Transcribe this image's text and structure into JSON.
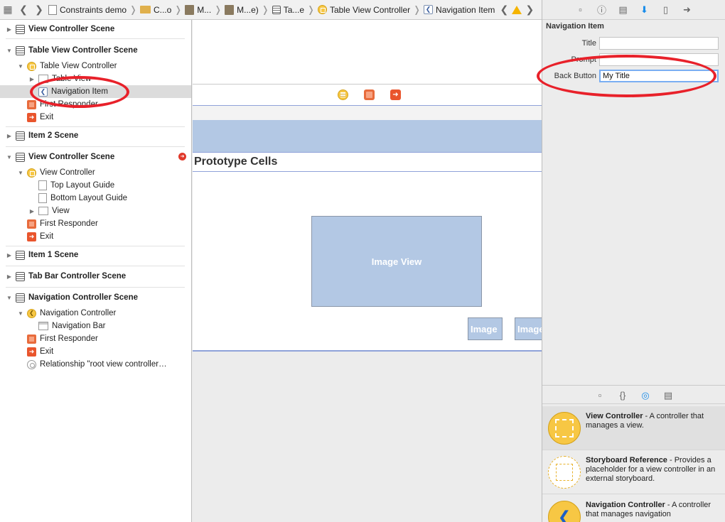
{
  "jumpbar": {
    "crumbs": [
      {
        "label": "Constraints demo",
        "icon": "project-file-icon"
      },
      {
        "label": "C...o",
        "icon": "folder-icon"
      },
      {
        "label": "M...",
        "icon": "storyboard-icon"
      },
      {
        "label": "M...e)",
        "icon": "storyboard-icon"
      },
      {
        "label": "Ta...e",
        "icon": "scene-icon"
      },
      {
        "label": "Table View Controller",
        "icon": "view-controller-icon"
      },
      {
        "label": "Navigation Item",
        "icon": "navigation-item-icon"
      }
    ]
  },
  "outline": {
    "rows": [
      {
        "label": "View Controller Scene",
        "kind": "scene"
      },
      {
        "label": "Table View Controller Scene",
        "kind": "scene"
      },
      {
        "label": "Table View Controller"
      },
      {
        "label": "Table View"
      },
      {
        "label": "Navigation Item"
      },
      {
        "label": "First Responder"
      },
      {
        "label": "Exit"
      },
      {
        "label": "Item 2 Scene",
        "kind": "scene"
      },
      {
        "label": "View Controller Scene",
        "kind": "scene"
      },
      {
        "label": "View Controller"
      },
      {
        "label": "Top Layout Guide"
      },
      {
        "label": "Bottom Layout Guide"
      },
      {
        "label": "View"
      },
      {
        "label": "First Responder"
      },
      {
        "label": "Exit"
      },
      {
        "label": "Item 1 Scene",
        "kind": "scene"
      },
      {
        "label": "Tab Bar Controller Scene",
        "kind": "scene"
      },
      {
        "label": "Navigation Controller Scene",
        "kind": "scene"
      },
      {
        "label": "Navigation Controller"
      },
      {
        "label": "Navigation Bar"
      },
      {
        "label": "First Responder"
      },
      {
        "label": "Exit"
      },
      {
        "label": "Relationship \"root view controller…"
      }
    ]
  },
  "canvas": {
    "prototype_header": "Prototype Cells",
    "image_view_label": "Image View",
    "image_small_1": "Image",
    "image_small_2": "Image"
  },
  "inspector": {
    "section_title": "Navigation Item",
    "fields": [
      {
        "label": "Title",
        "value": ""
      },
      {
        "label": "Prompt",
        "value": ""
      },
      {
        "label": "Back Button",
        "value": "My Title"
      }
    ]
  },
  "library": {
    "items": [
      {
        "title": "View Controller",
        "description": " - A controller that manages a view."
      },
      {
        "title": "Storyboard Reference",
        "description": " - Provides a placeholder for a view controller in an external storyboard."
      },
      {
        "title": "Navigation Controller",
        "description": " - A controller that manages navigation"
      }
    ]
  },
  "colors": {
    "annotation_red": "#e8212a",
    "selection_gray": "#dcdcdc",
    "cell_blue": "#b3c8e4",
    "active_tab_blue": "#1a8dea"
  }
}
